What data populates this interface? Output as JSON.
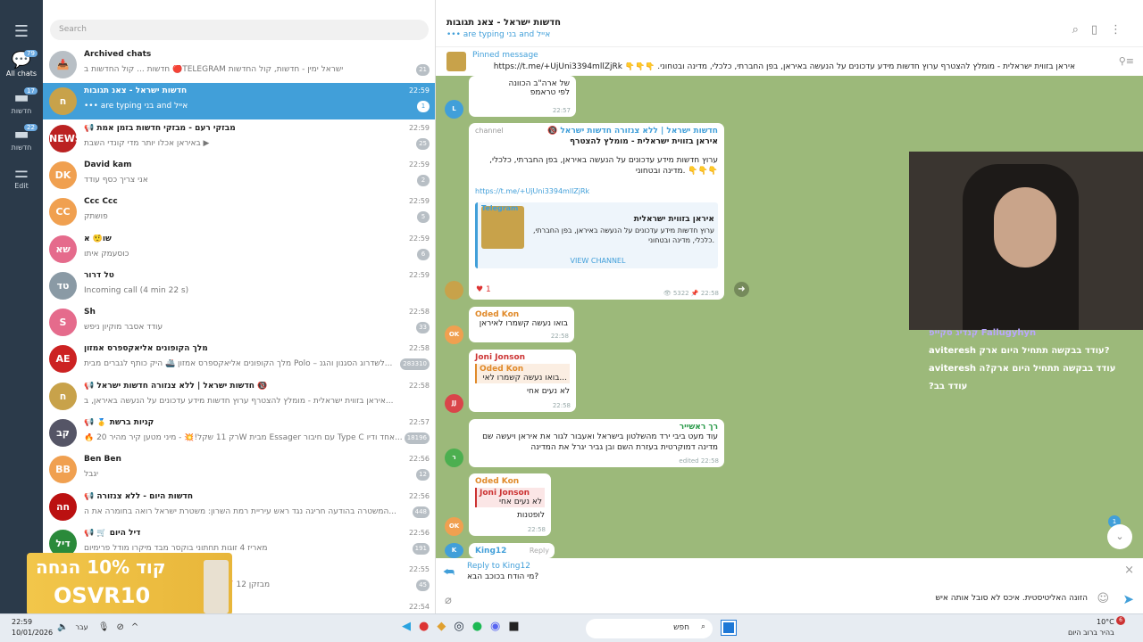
{
  "rail": {
    "all": "All chats",
    "all_badge": "79",
    "news": "חדשות",
    "news_badge": "17",
    "news2": "חדשות",
    "news2_badge": "22",
    "edit": "Edit"
  },
  "search": {
    "placeholder": "Search"
  },
  "chats": [
    {
      "name": "Archived chats",
      "preview": "חדשות ... קול החדשות ב 🔴TELEGRAM ישראל ימין - חדשות, קול החדשות",
      "time": "",
      "count": "21",
      "color": "#b8bfc5",
      "initials": "📥"
    },
    {
      "name": "חדשות ישראל - צאנ תגובות",
      "preview": "••• are typing בני and אייל",
      "time": "22:59",
      "count": "1",
      "color": "#c8a24a",
      "initials": "ח",
      "selected": true
    },
    {
      "name": "📢 מבזקי רעם - מבזקי חדשות בזמן אמת",
      "preview": "באיראן אכלו יותר מדי קונדי השבת ▶",
      "time": "22:59",
      "count": "25",
      "color": "#b22",
      "initials": "NEWS"
    },
    {
      "name": "David kam",
      "preview": "אני צריך כסף עודד",
      "time": "22:59",
      "count": "2",
      "color": "#f0a050",
      "initials": "DK"
    },
    {
      "name": "Ccc Ccc",
      "preview": "פושתק",
      "time": "22:59",
      "count": "5",
      "color": "#f0a050",
      "initials": "CC"
    },
    {
      "name": "שו🤨 א",
      "preview": "כוסעמק איתו",
      "time": "22:59",
      "count": "6",
      "color": "#e56b8c",
      "initials": "שא"
    },
    {
      "name": "טל דרור",
      "preview": "Incoming call (4 min 22 s)",
      "time": "22:59",
      "count": "",
      "color": "#8a9aa5",
      "initials": "טד"
    },
    {
      "name": "Sh",
      "preview": "עודד אסבר מוקיון ניפש",
      "time": "22:58",
      "count": "33",
      "color": "#e56b8c",
      "initials": "S"
    },
    {
      "name": "מלך הקופונים אליאקספרס אמזון",
      "preview": "מלך הקופונים אליאקספרס אמזון 🚢 היק כותף לגברים מבית Polo – לשדרוג הסגנון והגנ...",
      "time": "22:58",
      "count": "283310",
      "color": "#c22",
      "initials": "AE"
    },
    {
      "name": "📢 חדשות ישראל | ללא צנזורה חדשות ישראל 🔞",
      "preview": "איראן בזווית ישראלית - מומלץ להצטרף ערוץ חדשות מידע עדכונים על הנעשה באיראן, ב...",
      "time": "22:58",
      "count": "",
      "color": "#c8a24a",
      "initials": "ח"
    },
    {
      "name": "📢 🥇 קניות ברשת",
      "preview": "🔥 רק 11 שקל!💥 - מיני מטען קיר מהיר 20W מבית Essager עם חיבור Type C אחד ודיו...",
      "time": "22:57",
      "count": "18196",
      "color": "#556",
      "initials": "קב"
    },
    {
      "name": "Ben Ben",
      "preview": "יגבל",
      "time": "22:56",
      "count": "12",
      "color": "#f0a050",
      "initials": "BB"
    },
    {
      "name": "📢 חדשות היום - ללא צנזורה",
      "preview": "המשטרה בהודעה חריגה נגד ראש עיריית רמת השרון: משטרת ישראל רואה בחומרה את ה...",
      "time": "22:56",
      "count": "448",
      "color": "#b11",
      "initials": "חה"
    },
    {
      "name": "📢 🛒 דיל היום",
      "preview": "מאריז 4 זוגות תחתוני בוקסר מבד מיקרו מודל פרימיום",
      "time": "22:56",
      "count": "191",
      "color": "#2a8a3a",
      "initials": "דיל"
    },
    {
      "name": "",
      "preview": "מבזקן 12 📝 יריד הדמוקרטים יאיר גולן פונה למפגינים",
      "time": "22:55",
      "count": "45",
      "color": "#777",
      "initials": ""
    },
    {
      "name": "",
      "preview": "",
      "time": "22:54",
      "count": "",
      "color": "#777",
      "initials": ""
    }
  ],
  "header": {
    "title": "חדשות ישראל - צאנ תגובות",
    "typing": "••• are typing בני and אייל"
  },
  "pinned": {
    "label": "Pinned message",
    "text": "איראן בזווית ישראלית - מומלץ להצטרף ערוץ חדשות מידע עדכונים על הנעשה באיראן, בפן החברתי, כלכלי, מדינה ובטחוני. 👇👇👇 https://t.me/+UjUni3394mllZjRk"
  },
  "messages": {
    "m1": {
      "text1": "של ארה\"ב הכוונה",
      "text2": "לפי טראמפ",
      "time": "22:57"
    },
    "channel": {
      "from": "🔞 חדשות ישראל | ללא צנזורה חדשות ישראל",
      "tag": "channel",
      "title": "איראן בזווית ישראלית - מומלץ להצטרף",
      "body": "ערוץ חדשות מידע עדכונים על הנעשה באיראן, בפן החברתי, כלכלי, מדינה ובטחוני. 👇👇👇",
      "link": "https://t.me/+UjUni3394mllZjRk",
      "preview_site": "Telegram",
      "preview_title": "איראן בזווית ישראלית",
      "preview_body": "ערוץ חדשות מידע עדכונים על הנעשה באיראן, בפן החברתי, כלכלי, מדינה ובטחוני.",
      "view": "VIEW CHANNEL",
      "views": "5322",
      "time": "22:58",
      "react": "1"
    },
    "m2": {
      "author": "Oded Kon",
      "text": "בואו נעשה קשמרו לאיראן",
      "time": "22:58",
      "meta": "2"
    },
    "m3": {
      "author": "Joni Jonson",
      "reply_author": "Oded Kon",
      "reply_text": "בואו נעשה קשמרו לאי...",
      "text": "לא נעים אחי",
      "time": "22:58"
    },
    "m4": {
      "author": "רך ראשייר",
      "text": "עוד מעט ביבי ירד מהשלטון בישראל ואעבור לגור את איראן ויעשה שם מדינה דמוקרטית בעזרת השם ובן גביר יגרל את המדינה",
      "time": "edited 22:58"
    },
    "m5": {
      "author": "Oded Kon",
      "reply_author": "Joni Jonson",
      "reply_text": "לא נעים אחי",
      "text": "לופטנות",
      "time": "22:58"
    },
    "m6": {
      "author": "King12",
      "reply": "Reply"
    }
  },
  "scroll_badge": "1",
  "reply": {
    "to": "Reply to King12",
    "text": "מי הודח בכוכב הבא?"
  },
  "input": {
    "value": "הזונה האליטיסטית. איכס לא סובל אותה איש"
  },
  "overlay": {
    "l1": "קנדיג סקייפ Fallugyhyn",
    "l2": "aviteresh עודד בבקשה תתחיל היום ארק?",
    "l3": "aviteresh עודד בבקשה תתחיל היום ארק?ה",
    "l4": "?עודד בב"
  },
  "promo": {
    "line1": "קוד 10% הנחה",
    "line2": "OSVR10"
  },
  "taskbar": {
    "time": "22:59",
    "date": "10/01/2026",
    "lang": "עבר",
    "search": "חפש",
    "temp": "10°C",
    "weather": "בהיר ברוב היום",
    "weather_badge": "6"
  }
}
